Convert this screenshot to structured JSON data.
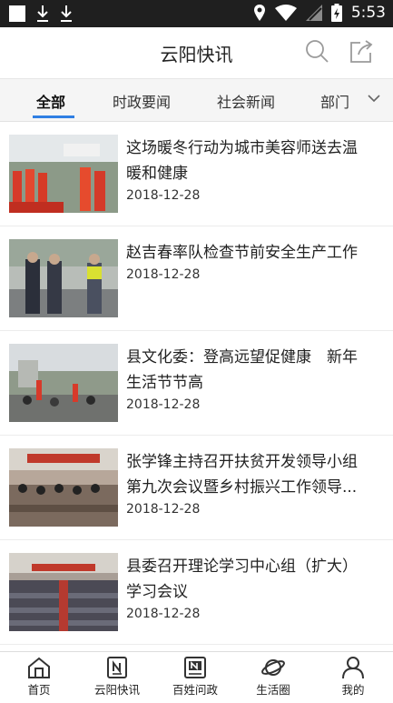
{
  "status_bar": {
    "time": "5:53",
    "icons": [
      "square-icon",
      "download-icon",
      "download-icon",
      "location-icon",
      "wifi-icon",
      "signal-icon",
      "battery-icon"
    ]
  },
  "header": {
    "title": "云阳快讯",
    "icons": [
      "search-icon",
      "share-icon"
    ]
  },
  "tabs": [
    {
      "label": "全部",
      "active": true
    },
    {
      "label": "时政要闻",
      "active": false
    },
    {
      "label": "社会新闻",
      "active": false
    },
    {
      "label": "部门",
      "active": false
    }
  ],
  "colors": {
    "accent": "#2f7fe3",
    "status_bar": "#1f1f1f"
  },
  "news": [
    {
      "title": "这场暖冬行动为城市美容师送去温暖和健康",
      "date": "2018-12-28"
    },
    {
      "title": "赵吉春率队检查节前安全生产工作",
      "date": "2018-12-28"
    },
    {
      "title": "县文化委：登高远望促健康　新年生活节节高",
      "date": "2018-12-28"
    },
    {
      "title": "张学锋主持召开扶贫开发领导小组第九次会议暨乡村振兴工作领导...",
      "date": "2018-12-28"
    },
    {
      "title": "县委召开理论学习中心组（扩大）学习会议",
      "date": "2018-12-28"
    }
  ],
  "bottom_nav": [
    {
      "label": "首页",
      "icon": "home-icon"
    },
    {
      "label": "云阳快讯",
      "icon": "news-icon"
    },
    {
      "label": "百姓问政",
      "icon": "newspaper-icon"
    },
    {
      "label": "生活圈",
      "icon": "planet-icon"
    },
    {
      "label": "我的",
      "icon": "person-icon"
    }
  ]
}
